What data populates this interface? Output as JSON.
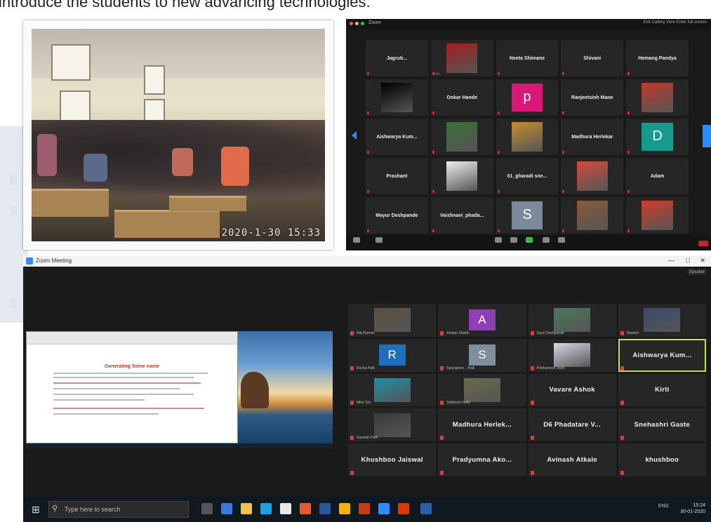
{
  "heading": {
    "text": "introduce the students to new advancing technologies."
  },
  "photo": {
    "timestamp": "2020-1-30 15:33"
  },
  "top_meeting": {
    "window_title": "Zoom",
    "top_right": "Exit  Gallery View  Enter full screen",
    "tiles": [
      {
        "kind": "name",
        "name": "Jagruti..."
      },
      {
        "kind": "image",
        "image": "ironman-avatar",
        "color": "#a31e1e",
        "sub": "Yash"
      },
      {
        "kind": "name",
        "name": "Neeta Shimane"
      },
      {
        "kind": "name",
        "name": "Shivani"
      },
      {
        "kind": "name",
        "name": "Hemang Pandya"
      },
      {
        "kind": "image",
        "image": "black-video",
        "color": "#000000",
        "sub": ""
      },
      {
        "kind": "name",
        "name": "Onkar Hande"
      },
      {
        "kind": "letter",
        "letter": "p",
        "color": "#d8197a",
        "sub": ""
      },
      {
        "kind": "name",
        "name": "Ranjeetsinh Mane"
      },
      {
        "kind": "image",
        "image": "person-photo",
        "color": "#c0392b",
        "sub": ""
      },
      {
        "kind": "name",
        "name": "Aishwarya Kum..."
      },
      {
        "kind": "image",
        "image": "person-photo",
        "color": "#3a6e3a",
        "sub": ""
      },
      {
        "kind": "image",
        "image": "sunset-photo",
        "color": "#c48d2a",
        "sub": ""
      },
      {
        "kind": "name",
        "name": "Madhura Herlekar"
      },
      {
        "kind": "letter",
        "letter": "D",
        "color": "#159a8c",
        "sub": ""
      },
      {
        "kind": "name",
        "name": "Prashant"
      },
      {
        "kind": "image",
        "image": "person-photo",
        "color": "#eeeeee",
        "sub": ""
      },
      {
        "kind": "name",
        "name": "01_gharadi sne..."
      },
      {
        "kind": "image",
        "image": "person-photo",
        "color": "#d44b3e",
        "sub": ""
      },
      {
        "kind": "name",
        "name": "Adam"
      },
      {
        "kind": "name",
        "name": "Mayur Deshpande"
      },
      {
        "kind": "name",
        "name": "Vaishnavi_phada..."
      },
      {
        "kind": "letter",
        "letter": "S",
        "color": "#7a8a9a",
        "sub": ""
      },
      {
        "kind": "image",
        "image": "person-photo",
        "color": "#8a5a3a",
        "sub": ""
      },
      {
        "kind": "image",
        "image": "cartoon-avatar",
        "color": "#d33a2a",
        "sub": ""
      }
    ]
  },
  "bottom_meeting": {
    "window_title": "Zoom Meeting",
    "view_button": "Speaker",
    "shared_doc": {
      "title": "Generating Some name"
    },
    "tiles": [
      {
        "kind": "image",
        "image": "person-photo",
        "color": "#5a5040",
        "sub": "Raj Parmar"
      },
      {
        "kind": "letter",
        "letter": "A",
        "color": "#8e3fb5",
        "sub": "Amaan Shaikh"
      },
      {
        "kind": "image",
        "image": "person-photo",
        "color": "#4a7a5a",
        "sub": "Gauri Deshpande"
      },
      {
        "kind": "image",
        "image": "person-photo",
        "color": "#3a4a6a",
        "sub": "Shardul"
      },
      {
        "kind": "letter",
        "letter": "R",
        "color": "#1f6fbf",
        "sub": "Rucha Patil"
      },
      {
        "kind": "letter",
        "letter": "S",
        "color": "#7d8f9c",
        "sub": "Saiyoginee ...Patil"
      },
      {
        "kind": "image",
        "image": "cartoon-avatar",
        "color": "#d8d8e8",
        "sub": "Prathamesh Joshi"
      },
      {
        "kind": "name",
        "name": "Aishwarya Kum...",
        "active": true
      },
      {
        "kind": "image",
        "image": "person-photo",
        "color": "#1d8fa8",
        "sub": "Mihir Dirt"
      },
      {
        "kind": "image",
        "image": "person-photo",
        "color": "#6a6a4a",
        "sub": "Siddhesh Hotle"
      },
      {
        "kind": "name",
        "name": "Vavare Ashok"
      },
      {
        "kind": "name",
        "name": "Kirti"
      },
      {
        "kind": "image",
        "image": "person-photo",
        "color": "#3a3a3a",
        "sub": "Saurabh Patil"
      },
      {
        "kind": "name",
        "name": "Madhura Herlek..."
      },
      {
        "kind": "name",
        "name": "D6 Phadatare V..."
      },
      {
        "kind": "name",
        "name": "Snehashri Gaste"
      },
      {
        "kind": "name",
        "name": "Khushboo Jaiswal"
      },
      {
        "kind": "name",
        "name": "Pradyumna Ako..."
      },
      {
        "kind": "name",
        "name": "Avinash Atkale"
      },
      {
        "kind": "name",
        "name": "khushboo"
      }
    ]
  },
  "taskbar": {
    "search_placeholder": "Type here to search",
    "clock_time": "15:24",
    "clock_date": "30-01-2020",
    "tray_text": "ENG"
  },
  "colors": {
    "zoom_blue": "#2d8cff",
    "zoom_dark": "#1a1a1a",
    "tile_dark": "#262626",
    "active_border": "#b8e05a",
    "mute_red": "#e03a3a"
  }
}
